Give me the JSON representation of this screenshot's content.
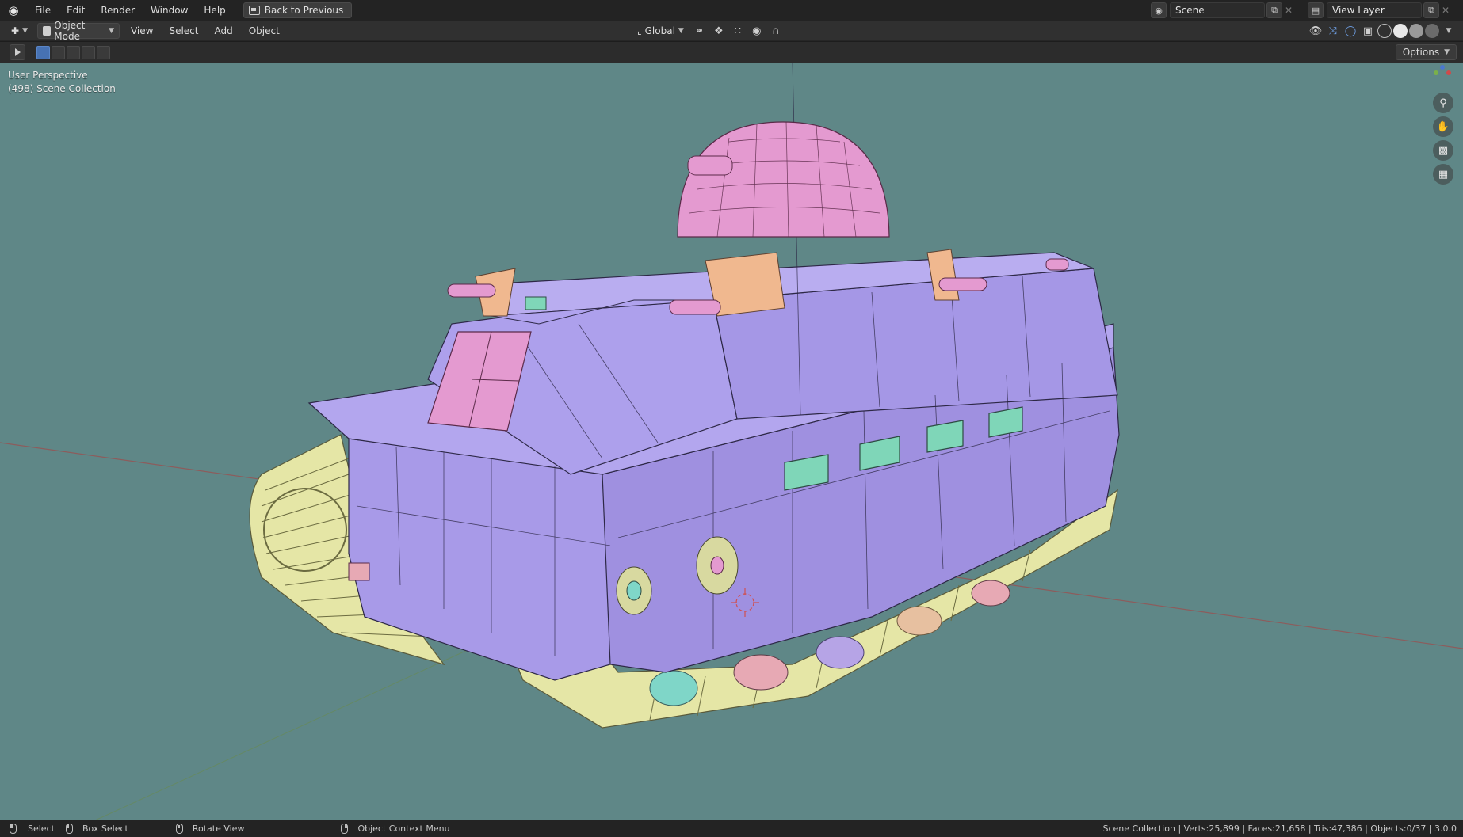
{
  "topbar": {
    "menus": [
      "File",
      "Edit",
      "Render",
      "Window",
      "Help"
    ],
    "back_button": "Back to Previous",
    "scene_name": "Scene",
    "view_layer_name": "View Layer"
  },
  "header": {
    "mode": "Object Mode",
    "menus": [
      "View",
      "Select",
      "Add",
      "Object"
    ],
    "transform_orientation": "Global"
  },
  "toolrow": {
    "options_label": "Options"
  },
  "viewport": {
    "perspective_label": "User Perspective",
    "collection_label": "(498) Scene Collection",
    "background_color": "#5f8787",
    "body_color": "#a89ae8",
    "dome_color": "#e49ad0",
    "track_color": "#e5e6a6",
    "window_color": "#7fd6b8"
  },
  "statusbar": {
    "select": "Select",
    "box_select": "Box Select",
    "rotate_view": "Rotate View",
    "context_menu": "Object Context Menu",
    "stats": "Scene Collection | Verts:25,899 | Faces:21,658 | Tris:47,386 | Objects:0/37 | 3.0.0"
  }
}
